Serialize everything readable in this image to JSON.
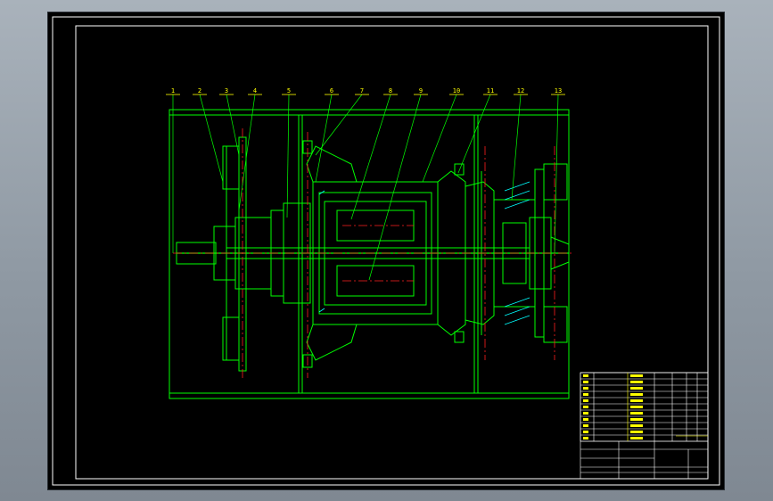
{
  "balloons": [
    "1",
    "2",
    "3",
    "4",
    "5",
    "6",
    "7",
    "8",
    "9",
    "10",
    "11",
    "12",
    "13"
  ],
  "colors": {
    "background": "#000000",
    "frame": "#ffffff",
    "outline": "#00ff00",
    "centerline": "#ff2020",
    "labels": "#ffff00",
    "hatch": "#00ffff",
    "viewport": "#9aa3ad"
  },
  "icons": [
    "motor-cross-section",
    "title-block-table"
  ]
}
